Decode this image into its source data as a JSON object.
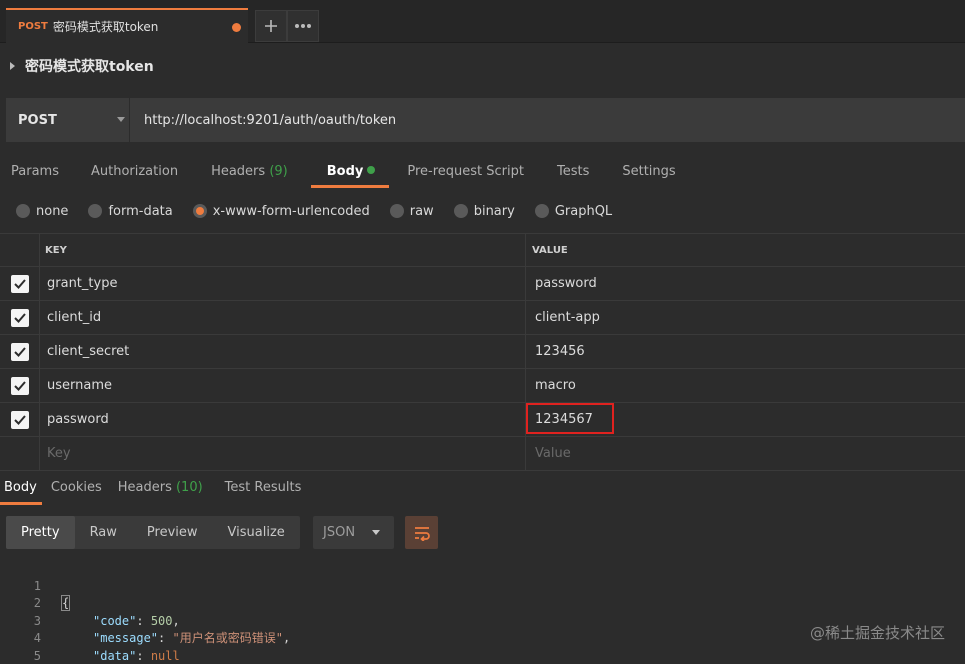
{
  "tab": {
    "method": "POST",
    "title": "密码模式获取token"
  },
  "request": {
    "name": "密码模式获取token",
    "method": "POST",
    "url": "http://localhost:9201/auth/oauth/token"
  },
  "request_tabs": [
    {
      "label": "Params"
    },
    {
      "label": "Authorization"
    },
    {
      "label": "Headers",
      "count": "(9)"
    },
    {
      "label": "Body",
      "active": true
    },
    {
      "label": "Pre-request Script"
    },
    {
      "label": "Tests"
    },
    {
      "label": "Settings"
    }
  ],
  "body_types": [
    {
      "label": "none"
    },
    {
      "label": "form-data"
    },
    {
      "label": "x-www-form-urlencoded",
      "selected": true
    },
    {
      "label": "raw"
    },
    {
      "label": "binary"
    },
    {
      "label": "GraphQL"
    }
  ],
  "table": {
    "key_header": "KEY",
    "value_header": "VALUE",
    "rows": [
      {
        "key": "grant_type",
        "value": "password",
        "checked": true
      },
      {
        "key": "client_id",
        "value": "client-app",
        "checked": true
      },
      {
        "key": "client_secret",
        "value": "123456",
        "checked": true
      },
      {
        "key": "username",
        "value": "macro",
        "checked": true
      },
      {
        "key": "password",
        "value": "1234567",
        "checked": true
      }
    ],
    "key_placeholder": "Key",
    "value_placeholder": "Value"
  },
  "response_tabs": [
    {
      "label": "Body",
      "active": true
    },
    {
      "label": "Cookies"
    },
    {
      "label": "Headers",
      "count": "(10)"
    },
    {
      "label": "Test Results"
    }
  ],
  "view_modes": [
    "Pretty",
    "Raw",
    "Preview",
    "Visualize"
  ],
  "format": "JSON",
  "response_code": {
    "line_numbers": [
      "1",
      "2",
      "3",
      "4",
      "5"
    ],
    "open_brace": "{",
    "close_brace": "}",
    "fields": [
      {
        "key": "\"code\"",
        "value": "500",
        "trail": ","
      },
      {
        "key": "\"message\"",
        "value": "\"用户名或密码错误\"",
        "trail": ","
      },
      {
        "key": "\"data\"",
        "value": "null",
        "trail": ""
      }
    ]
  },
  "watermark": "@稀土掘金技术社区",
  "colors": {
    "accent": "#ef7c3f",
    "success": "#3fa04a",
    "highlight_border": "#e0221f"
  }
}
